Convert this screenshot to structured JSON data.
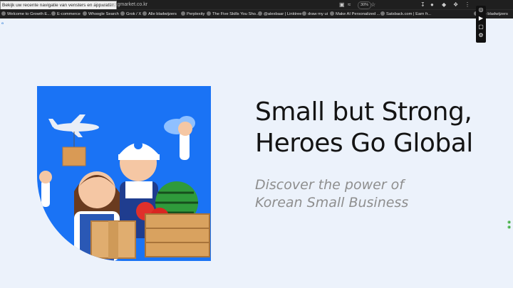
{
  "browser": {
    "tooltip": "Bekijk uw recente navigatie van vensters en apparaten",
    "url": "mg.gmarket.co.kr",
    "zoom": "30%",
    "bookmarks": [
      "Welcome to Growth E...",
      "E-commerce",
      "Whoogle Search",
      "Grok / X",
      "Alle bladwijzers",
      "Perplexity",
      "The Five Skills You Sho...",
      "@alexbaar | Linktree",
      "draw my ui",
      "Make AI Personalized ...",
      "Satsback.com | Earn fr...",
      "Alle bladwijzers"
    ]
  },
  "page": {
    "headline_line1": "Small but Strong,",
    "headline_line2": "Heroes Go Global",
    "sub_line1": "Discover the power of",
    "sub_line2": "Korean Small Business"
  },
  "colors": {
    "page_bg": "#ecf2fb",
    "hero_blue": "#1a73f5",
    "headline": "#141414",
    "subline": "#8e8e8e"
  }
}
